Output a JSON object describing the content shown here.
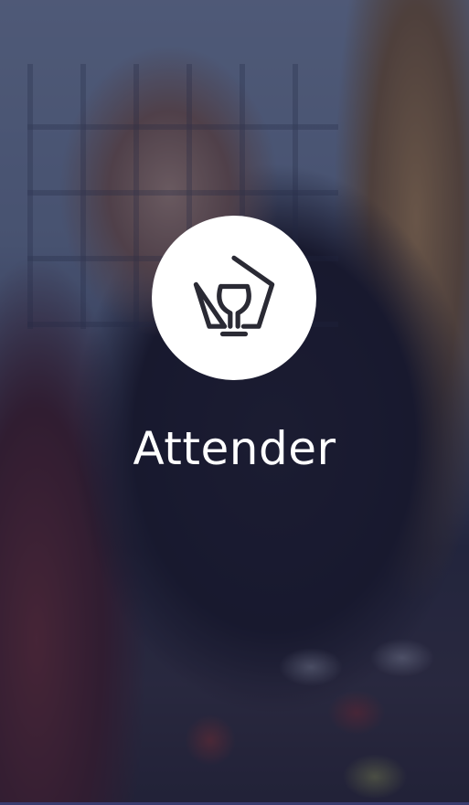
{
  "app": {
    "name": "Attender",
    "logo_icon": "pentagon-glass-icon"
  },
  "colors": {
    "overlay": "#1c1e3e",
    "logo_background": "#ffffff",
    "logo_stroke": "#2a2a34",
    "text": "#ffffff"
  }
}
